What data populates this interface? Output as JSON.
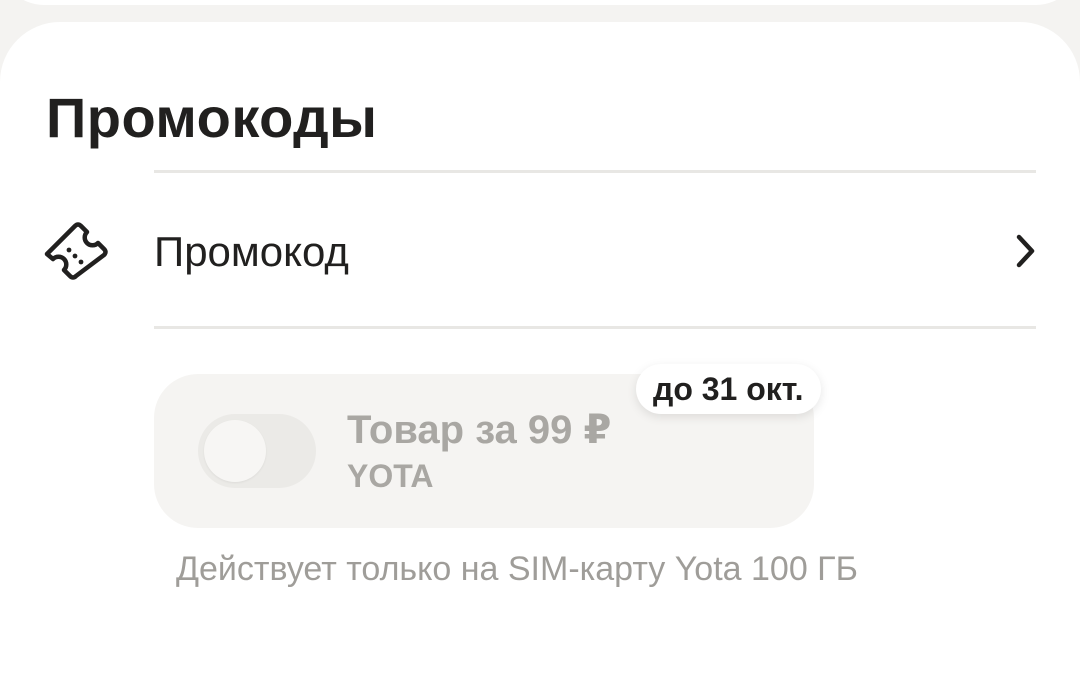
{
  "section": {
    "title": "Промокоды"
  },
  "promo_row": {
    "label": "Промокод",
    "icon": "ticket-icon",
    "trailing_icon": "chevron-right-icon"
  },
  "offer": {
    "toggle_on": false,
    "title": "Товар за 99 ₽",
    "brand": "YOTA",
    "deadline": "до 31 окт.",
    "note": "Действует только на SIM-карту Yota 100 ГБ"
  },
  "colors": {
    "background": "#f4f3f1",
    "card": "#ffffff",
    "text_primary": "#21201f",
    "text_disabled": "#a9a7a3",
    "offer_card": "#f5f4f2"
  }
}
